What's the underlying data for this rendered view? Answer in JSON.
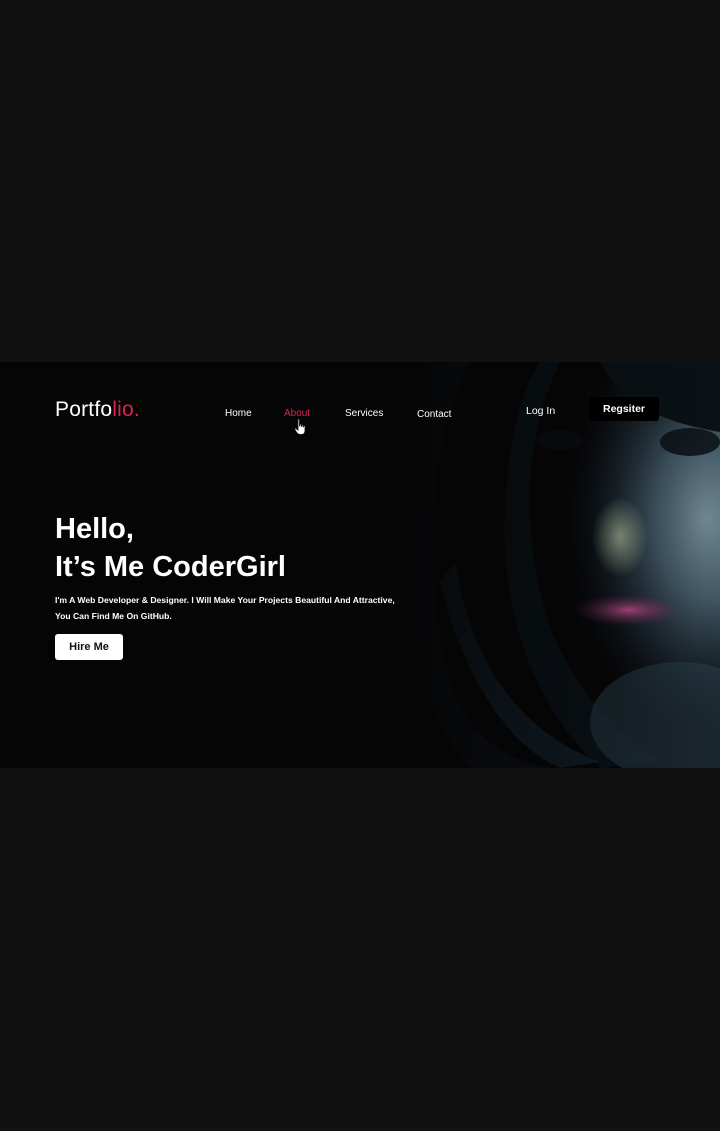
{
  "logo": {
    "main": "Portfo",
    "accent": "lio."
  },
  "nav": {
    "home": "Home",
    "about": "About",
    "services": "Services",
    "contact": "Contact"
  },
  "auth": {
    "login": "Log In",
    "register": "Regsiter"
  },
  "hero": {
    "line1": "Hello,",
    "line2": "It’s Me CoderGirl",
    "desc_line1": "I'm A Web Developer & Designer. I Will Make Your Projects Beautiful And Attractive,",
    "desc_line2": "You Can Find Me On GitHub.",
    "cta": "Hire Me"
  },
  "colors": {
    "accent": "#e0204f",
    "background": "#050506",
    "frame": "#111112"
  }
}
